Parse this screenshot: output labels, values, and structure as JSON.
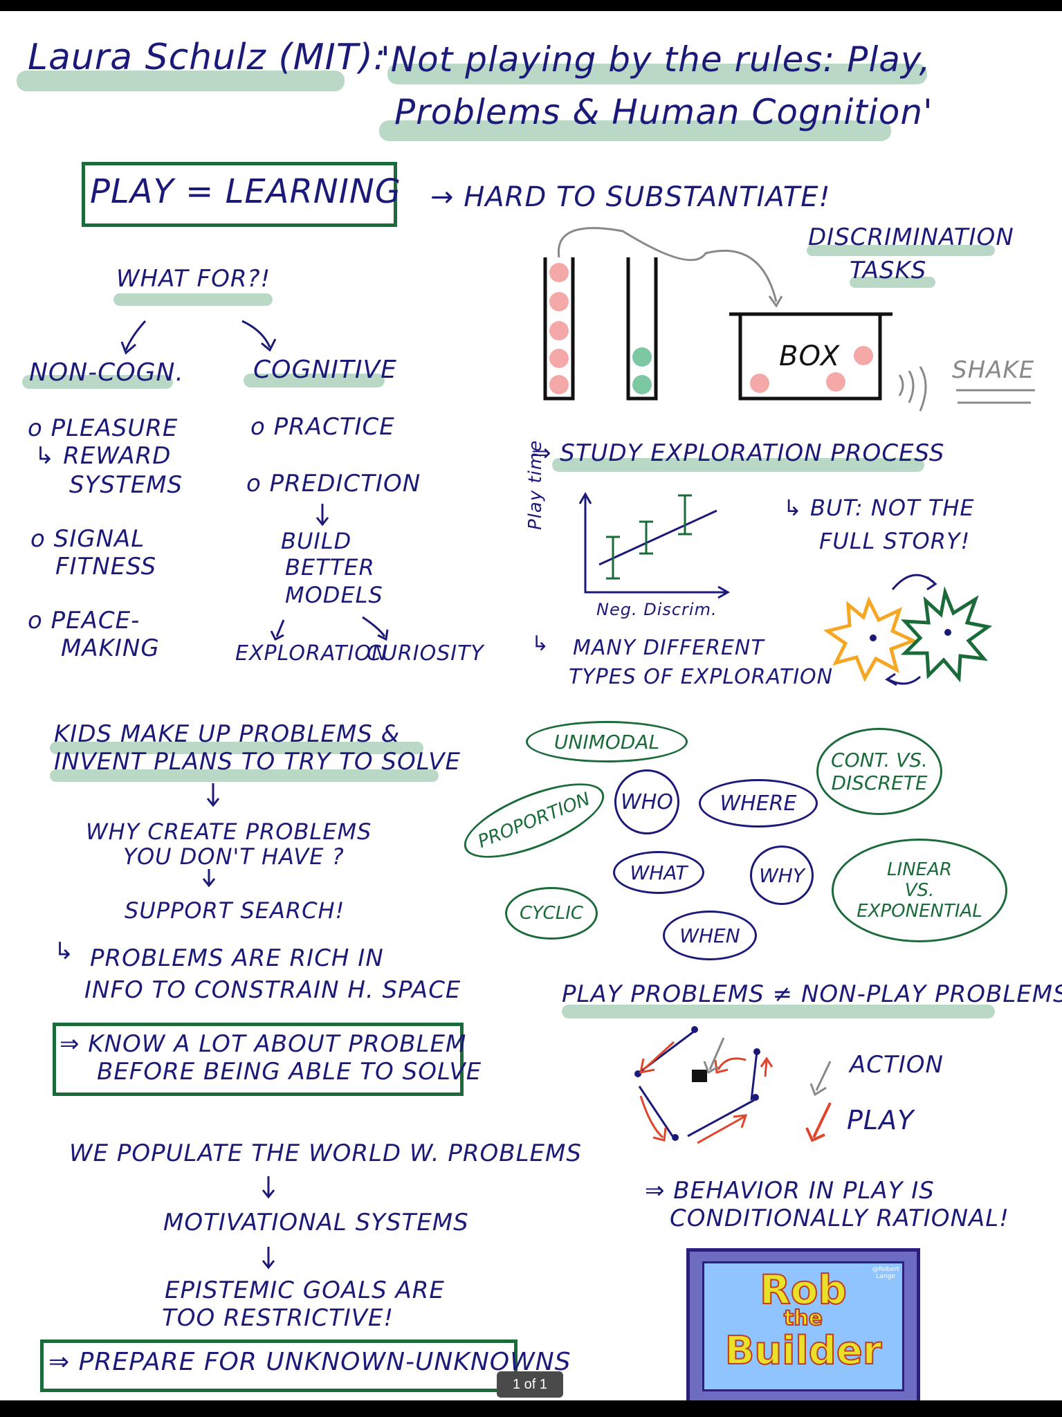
{
  "header": {
    "speaker": "Laura Schulz (MIT):",
    "title_line1": "'Not playing by the rules: Play,",
    "title_line2": "Problems & Human Cognition'"
  },
  "left": {
    "play_box": "PLAY = LEARNING",
    "what_for": "WHAT FOR?!",
    "non_cogn": "NON-COGN.",
    "cognitive": "COGNITIVE",
    "non_cogn_items": [
      "o PLEASURE",
      "↳ REWARD",
      "SYSTEMS",
      "o SIGNAL",
      "FITNESS",
      "o PEACE-",
      "MAKING"
    ],
    "cog_items": [
      "o PRACTICE",
      "o PREDICTION",
      "BUILD",
      "BETTER",
      "MODELS",
      "EXPLORATION",
      "CURIOSITY"
    ],
    "kids_line1": "KIDS MAKE UP PROBLEMS &",
    "kids_line2": "INVENT PLANS TO TRY TO SOLVE",
    "why_line1": "WHY CREATE PROBLEMS",
    "why_line2": "YOU DON'T HAVE ?",
    "support": "SUPPORT SEARCH!",
    "rich_line1": "PROBLEMS ARE RICH IN",
    "rich_line2": "INFO TO CONSTRAIN H. SPACE",
    "know_line1": "⇒ KNOW A LOT ABOUT PROBLEM",
    "know_line2": "BEFORE BEING ABLE TO SOLVE",
    "populate": "WE POPULATE THE WORLD W. PROBLEMS",
    "motivational": "MOTIVATIONAL SYSTEMS",
    "epistemic_line1": "EPISTEMIC GOALS ARE",
    "epistemic_line2": "TOO RESTRICTIVE!",
    "prepare": "⇒ PREPARE FOR UNKNOWN-UNKNOWNS"
  },
  "right": {
    "hard": "→ HARD TO SUBSTANTIATE!",
    "discrimination_line1": "DISCRIMINATION",
    "discrimination_line2": "TASKS",
    "box_label": "BOX",
    "shake": "SHAKE",
    "study": "⇒ STUDY EXPLORATION PROCESS",
    "graph_y": "Play time",
    "graph_x": "Neg. Discrim.",
    "but_line1": "↳ BUT: NOT THE",
    "but_line2": "FULL STORY!",
    "many_line1": "MANY DIFFERENT",
    "many_line2": "TYPES OF EXPLORATION",
    "ovals": {
      "unimodal": "UNIMODAL",
      "cont_line1": "CONT. VS.",
      "cont_line2": "DISCRETE",
      "proportion": "PROPORTION",
      "who": "WHO",
      "where": "WHERE",
      "what": "WHAT",
      "why": "WHY",
      "cyclic": "CYCLIC",
      "when": "WHEN",
      "linear_line1": "LINEAR",
      "linear_line2": "VS.",
      "linear_line3": "EXPONENTIAL"
    },
    "play_problems": "PLAY PROBLEMS ≠ NON-PLAY PROBLEMS",
    "action": "ACTION",
    "play": "PLAY",
    "behavior_line1": "⇒ BEHAVIOR IN PLAY IS",
    "behavior_line2": "CONDITIONALLY RATIONAL!",
    "rob_line1": "Rob",
    "rob_line2": "the",
    "rob_line3": "Builder",
    "rob_credit": "@Robert Lange"
  },
  "ui": {
    "page_indicator": "1 of 1"
  },
  "colors": {
    "ink": "#1c1a78",
    "green": "#1b6b3a",
    "highlight": "#a8cfb8",
    "pink": "#f4a8a8",
    "orange": "#f5a623",
    "red": "#e0452b"
  }
}
